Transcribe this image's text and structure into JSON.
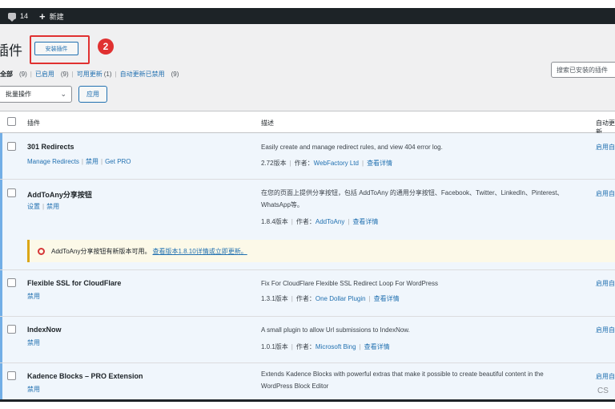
{
  "admin_bar": {
    "comments_count": "14",
    "new_label": "新建"
  },
  "page": {
    "title": "插件",
    "add_plugin_button": "安装插件",
    "step_badge": "2"
  },
  "filters": [
    {
      "label": "全部",
      "count": "(9)",
      "current": true
    },
    {
      "label": "已启用",
      "count": "(9)"
    },
    {
      "label": "可用更新",
      "count": "(1)"
    },
    {
      "label": "自动更新已禁用",
      "count": "(9)"
    }
  ],
  "search": {
    "placeholder": "搜索已安装的插件"
  },
  "bulk": {
    "selected": "批量操作",
    "apply_label": "应用"
  },
  "table": {
    "headers": {
      "plugin": "插件",
      "description": "描述",
      "auto_update": "自动更新"
    },
    "rows": [
      {
        "name": "301 Redirects",
        "actions": [
          "Manage Redirects",
          "禁用",
          "Get PRO"
        ],
        "description": "Easily create and manage redirect rules, and view 404 error log.",
        "version": "2.72版本",
        "author_label": "作者：",
        "author": "WebFactory Ltd",
        "details": "查看详情",
        "auto": "启用自动更新"
      },
      {
        "name": "AddToAny分享按钮",
        "actions": [
          "设置",
          "禁用"
        ],
        "description": "在您的页面上提供分享按钮，包括 AddToAny 的通用分享按钮、Facebook、Twitter、LinkedIn、Pinterest、WhatsApp等。",
        "version": "1.8.4版本",
        "author_label": "作者：",
        "author": "AddToAny",
        "details": "查看详情",
        "auto": "启用自动更新"
      },
      {
        "name": "Flexible SSL for CloudFlare",
        "actions": [
          "禁用"
        ],
        "description": "Fix For CloudFlare Flexible SSL Redirect Loop For WordPress",
        "version": "1.3.1版本",
        "author_label": "作者：",
        "author": "One Dollar Plugin",
        "details": "查看详情",
        "auto": "启用自动更新"
      },
      {
        "name": "IndexNow",
        "actions": [
          "禁用"
        ],
        "description": "A small plugin to allow Url submissions to IndexNow.",
        "version": "1.0.1版本",
        "author_label": "作者：",
        "author": "Microsoft Bing",
        "details": "查看详情",
        "auto": "启用自动更新"
      },
      {
        "name": "Kadence Blocks – PRO Extension",
        "actions": [
          "禁用"
        ],
        "description": "Extends Kadence Blocks with powerful extras that make it possible to create beautiful content in the WordPress Block Editor",
        "auto": "启用自动更新"
      }
    ],
    "update_notice": {
      "text": "AddToAny分享按钮有新版本可用。",
      "link": "查看版本1.8.10详情或立即更新。"
    }
  },
  "watermark": "CS"
}
